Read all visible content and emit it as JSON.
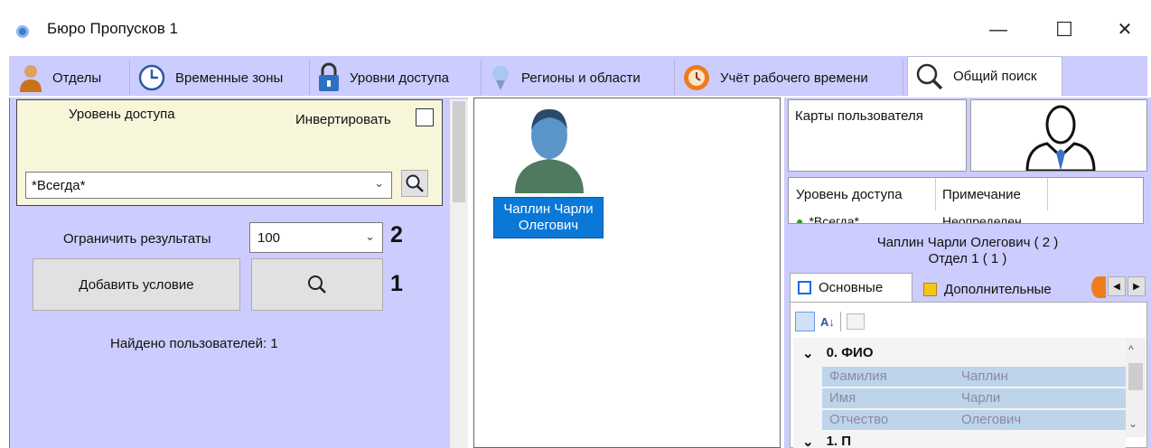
{
  "window": {
    "title": "Бюро Пропусков 1",
    "minimize": "—",
    "maximize": "☐",
    "close": "✕"
  },
  "tabs": [
    {
      "label": "Отделы",
      "icon": "person-icon"
    },
    {
      "label": "Временные зоны",
      "icon": "clock-icon"
    },
    {
      "label": "Уровни доступа",
      "icon": "lock-icon"
    },
    {
      "label": "Регионы и области",
      "icon": "map-pin-icon"
    },
    {
      "label": "Учёт рабочего времени",
      "icon": "alarm-clock-icon"
    },
    {
      "label": "Общий поиск",
      "icon": "search-icon",
      "active": true
    }
  ],
  "condition": {
    "level_label": "Уровень доступа",
    "invert_label": "Инвертировать",
    "invert_checked": false,
    "selected_value": "*Всегда*"
  },
  "search": {
    "limit_label": "Ограничить результаты",
    "limit_value": "100",
    "callout_2": "2",
    "add_condition_label": "Добавить условие",
    "callout_1": "1",
    "found_text": "Найдено пользователей: 1"
  },
  "results": [
    {
      "name": "Чаплин Чарли Олегович"
    }
  ],
  "details": {
    "cards_header": "Карты пользователя",
    "access_col_level": "Уровень доступа",
    "access_col_note": "Примечание",
    "access_row_level": "*Всегда*",
    "access_row_note": "Неопределен",
    "user_name_line": "Чаплин Чарли Олегович ( 2 )",
    "department_line": "Отдел 1 ( 1 )",
    "tab_main": "Основные",
    "tab_extra": "Дополнительные",
    "section_fio": "0. ФИО",
    "section_next": "1. П",
    "properties": [
      {
        "name": "Фамилия",
        "value": "Чаплин"
      },
      {
        "name": "Имя",
        "value": "Чарли"
      },
      {
        "name": "Отчество",
        "value": "Олегович"
      }
    ]
  },
  "colors": {
    "panel": "#ccccff",
    "condition_bg": "#f7f6db",
    "selection": "#0a78d7"
  }
}
